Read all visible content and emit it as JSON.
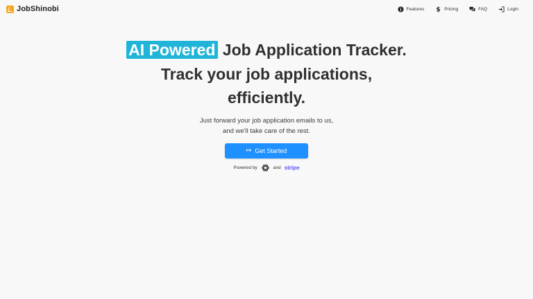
{
  "brand": {
    "name": "JobShinobi",
    "logo_color": "#f5a623"
  },
  "nav": {
    "items": [
      {
        "label": "Features",
        "icon": "info-circle-icon"
      },
      {
        "label": "Pricing",
        "icon": "dollar-icon"
      },
      {
        "label": "FAQ",
        "icon": "chat-bubbles-icon"
      },
      {
        "label": "Login",
        "icon": "login-arrow-icon"
      }
    ]
  },
  "hero": {
    "highlight": "AI Powered",
    "title_rest": " Job Application Tracker.",
    "line2": "Track your job applications,",
    "line3": "efficiently.",
    "sub_line1": "Just forward your job application emails to us,",
    "sub_line2": "and we'll take care of the rest.",
    "cta_icon": "↦",
    "cta_label": "Get Started",
    "powered_prefix": "Powered by",
    "powered_and": "and",
    "stripe_text": "stripe"
  },
  "colors": {
    "highlight_bg": "#1fb4d8",
    "cta_bg": "#1e90ff",
    "stripe": "#635bff"
  }
}
